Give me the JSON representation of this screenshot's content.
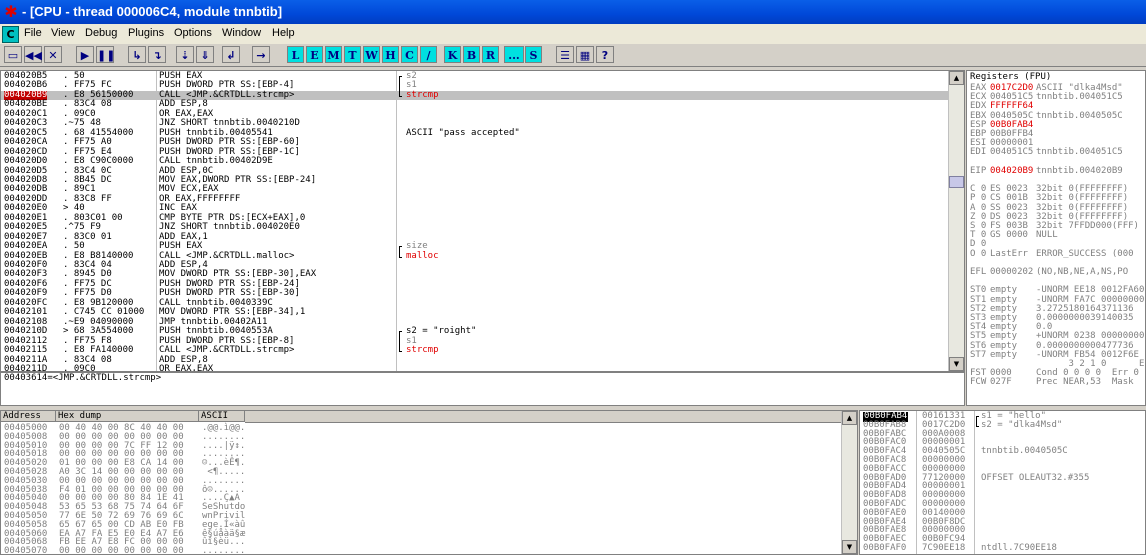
{
  "window": {
    "title": "- [CPU - thread 000006C4, module tnnbtib]",
    "app_icon": "bug-icon"
  },
  "menu": {
    "c_label": "C",
    "items": [
      "File",
      "View",
      "Debug",
      "Plugins",
      "Options",
      "Window",
      "Help"
    ]
  },
  "toolbar": {
    "icon_buttons": [
      "open-icon",
      "rewind-icon",
      "close-icon",
      "run-icon",
      "pause-icon",
      "step-into-icon",
      "step-over-icon",
      "trace-into-icon",
      "trace-over-icon",
      "execute-till-return-icon",
      "goto-icon"
    ],
    "letters": [
      "L",
      "E",
      "M",
      "T",
      "W",
      "H",
      "C",
      "/",
      "K",
      "B",
      "R",
      "...",
      "S"
    ],
    "right_icons": [
      "list-icon",
      "grid-icon",
      "help-icon"
    ]
  },
  "disasm": {
    "rows": [
      {
        "addr": "004020B5",
        "hex": ". 50",
        "cmd": "PUSH EAX",
        "cmt": "s2",
        "mark": "top",
        "cmt_color": "gray"
      },
      {
        "addr": "004020B6",
        "hex": ". FF75 FC",
        "cmd": "PUSH DWORD PTR SS:[EBP-4]",
        "cmt": "s1",
        "mark": "mid",
        "cmt_color": "gray"
      },
      {
        "addr": "004020B9",
        "hex": ". E8 56150000",
        "cmd": "CALL <JMP.&CRTDLL.strcmp>",
        "cmt": "strcmp",
        "mark": "bot",
        "cmt_color": "red",
        "selected": true
      },
      {
        "addr": "004020BE",
        "hex": ". 83C4 08",
        "cmd": "ADD ESP,8",
        "cmt": ""
      },
      {
        "addr": "004020C1",
        "hex": ". 09C0",
        "cmd": "OR EAX,EAX",
        "cmt": ""
      },
      {
        "addr": "004020C3",
        "hex": ".~75 48",
        "cmd": "JNZ SHORT tnnbtib.0040210D",
        "cmt": ""
      },
      {
        "addr": "004020C5",
        "hex": ". 68 41554000",
        "cmd": "PUSH tnnbtib.00405541",
        "cmt": "ASCII \"pass accepted\"",
        "cmt_color": "black"
      },
      {
        "addr": "004020CA",
        "hex": ". FF75 A0",
        "cmd": "PUSH DWORD PTR SS:[EBP-60]",
        "cmt": ""
      },
      {
        "addr": "004020CD",
        "hex": ". FF75 E4",
        "cmd": "PUSH DWORD PTR SS:[EBP-1C]",
        "cmt": ""
      },
      {
        "addr": "004020D0",
        "hex": ". E8 C90C0000",
        "cmd": "CALL tnnbtib.00402D9E",
        "cmt": ""
      },
      {
        "addr": "004020D5",
        "hex": ". 83C4 0C",
        "cmd": "ADD ESP,0C",
        "cmt": ""
      },
      {
        "addr": "004020D8",
        "hex": ". 8B45 DC",
        "cmd": "MOV EAX,DWORD PTR SS:[EBP-24]",
        "cmt": ""
      },
      {
        "addr": "004020DB",
        "hex": ". 89C1",
        "cmd": "MOV ECX,EAX",
        "cmt": ""
      },
      {
        "addr": "004020DD",
        "hex": ". 83C8 FF",
        "cmd": "OR EAX,FFFFFFFF",
        "cmt": ""
      },
      {
        "addr": "004020E0",
        "hex": "> 40",
        "cmd": "INC EAX",
        "cmt": ""
      },
      {
        "addr": "004020E1",
        "hex": ". 803C01 00",
        "cmd": "CMP BYTE PTR DS:[ECX+EAX],0",
        "cmt": ""
      },
      {
        "addr": "004020E5",
        "hex": ".^75 F9",
        "cmd": "JNZ SHORT tnnbtib.004020E0",
        "cmt": ""
      },
      {
        "addr": "004020E7",
        "hex": ". 83C0 01",
        "cmd": "ADD EAX,1",
        "cmt": ""
      },
      {
        "addr": "004020EA",
        "hex": ". 50",
        "cmd": "PUSH EAX",
        "cmt": "size",
        "mark": "top",
        "cmt_color": "gray"
      },
      {
        "addr": "004020EB",
        "hex": ". E8 B8140000",
        "cmd": "CALL <JMP.&CRTDLL.malloc>",
        "cmt": "malloc",
        "mark": "bot",
        "cmt_color": "red"
      },
      {
        "addr": "004020F0",
        "hex": ". 83C4 04",
        "cmd": "ADD ESP,4",
        "cmt": ""
      },
      {
        "addr": "004020F3",
        "hex": ". 8945 D0",
        "cmd": "MOV DWORD PTR SS:[EBP-30],EAX",
        "cmt": ""
      },
      {
        "addr": "004020F6",
        "hex": ". FF75 DC",
        "cmd": "PUSH DWORD PTR SS:[EBP-24]",
        "cmt": ""
      },
      {
        "addr": "004020F9",
        "hex": ". FF75 D0",
        "cmd": "PUSH DWORD PTR SS:[EBP-30]",
        "cmt": ""
      },
      {
        "addr": "004020FC",
        "hex": ". E8 9B120000",
        "cmd": "CALL tnnbtib.0040339C",
        "cmt": ""
      },
      {
        "addr": "00402101",
        "hex": ". C745 CC 01000",
        "cmd": "MOV DWORD PTR SS:[EBP-34],1",
        "cmt": ""
      },
      {
        "addr": "00402108",
        "hex": ".~E9 04090000",
        "cmd": "JMP tnnbtib.00402A11",
        "cmt": ""
      },
      {
        "addr": "0040210D",
        "hex": "> 68 3A554000",
        "cmd": "PUSH tnnbtib.0040553A",
        "cmt": "s2 = \"roight\"",
        "mark": "top",
        "cmt_color": "black"
      },
      {
        "addr": "00402112",
        "hex": ". FF75 F8",
        "cmd": "PUSH DWORD PTR SS:[EBP-8]",
        "cmt": "s1",
        "mark": "mid",
        "cmt_color": "gray"
      },
      {
        "addr": "00402115",
        "hex": ". E8 FA140000",
        "cmd": "CALL <JMP.&CRTDLL.strcmp>",
        "cmt": "strcmp",
        "mark": "bot",
        "cmt_color": "red"
      },
      {
        "addr": "0040211A",
        "hex": ". 83C4 08",
        "cmd": "ADD ESP,8",
        "cmt": ""
      },
      {
        "addr": "0040211D",
        "hex": ". 09C0",
        "cmd": "OR EAX,EAX",
        "cmt": ""
      },
      {
        "addr": "0040211F",
        "hex": ".~75 2A",
        "cmd": "JNZ SHORT tnnbtib.0040214B",
        "cmt": ""
      }
    ],
    "info": "00403614=<JMP.&CRTDLL.strcmp>"
  },
  "registers": {
    "header": "Registers (FPU)",
    "lines": [
      {
        "name": "EAX",
        "val": "0017C2D0",
        "desc": "ASCII \"dlka4Msd\"",
        "red": true
      },
      {
        "name": "ECX",
        "val": "004051C5",
        "desc": "tnnbtib.004051C5",
        "red": false
      },
      {
        "name": "EDX",
        "val": "FFFFFF64",
        "desc": "",
        "red": true
      },
      {
        "name": "EBX",
        "val": "0040505C",
        "desc": "tnnbtib.0040505C",
        "red": false
      },
      {
        "name": "ESP",
        "val": "00B0FAB4",
        "desc": "",
        "red": true
      },
      {
        "name": "EBP",
        "val": "00B0FFB4",
        "desc": "",
        "red": false
      },
      {
        "name": "ESI",
        "val": "00000001",
        "desc": "",
        "red": false
      },
      {
        "name": "EDI",
        "val": "004051C5",
        "desc": "tnnbtib.004051C5",
        "red": false
      },
      {
        "name": "",
        "val": "",
        "desc": "",
        "red": false
      },
      {
        "name": "EIP",
        "val": "004020B9",
        "desc": "tnnbtib.004020B9",
        "red": true
      },
      {
        "name": "",
        "val": "",
        "desc": "",
        "red": false
      },
      {
        "name": "C 0",
        "val": "ES 0023",
        "desc": "32bit 0(FFFFFFFF)",
        "red": false
      },
      {
        "name": "P 0",
        "val": "CS 001B",
        "desc": "32bit 0(FFFFFFFF)",
        "red": false
      },
      {
        "name": "A 0",
        "val": "SS 0023",
        "desc": "32bit 0(FFFFFFFF)",
        "red": false
      },
      {
        "name": "Z 0",
        "val": "DS 0023",
        "desc": "32bit 0(FFFFFFFF)",
        "red": false
      },
      {
        "name": "S 0",
        "val": "FS 003B",
        "desc": "32bit 7FFDD000(FFF)",
        "red": false
      },
      {
        "name": "T 0",
        "val": "GS 0000",
        "desc": "NULL",
        "red": false
      },
      {
        "name": "D 0",
        "val": "",
        "desc": "",
        "red": false
      },
      {
        "name": "O 0",
        "val": "LastErr",
        "desc": "ERROR_SUCCESS (000",
        "red": false
      },
      {
        "name": "",
        "val": "",
        "desc": "",
        "red": false
      },
      {
        "name": "EFL",
        "val": "00000202",
        "desc": "(NO,NB,NE,A,NS,PO",
        "red": false
      },
      {
        "name": "",
        "val": "",
        "desc": "",
        "red": false
      },
      {
        "name": "ST0",
        "val": "empty",
        "desc": "-UNORM EE18 0012FA60",
        "red": false
      },
      {
        "name": "ST1",
        "val": "empty",
        "desc": "-UNORM FA7C 00000000",
        "red": false
      },
      {
        "name": "ST2",
        "val": "empty",
        "desc": "3.2725180164371136",
        "red": false
      },
      {
        "name": "ST3",
        "val": "empty",
        "desc": "0.0000000039140035",
        "red": false
      },
      {
        "name": "ST4",
        "val": "empty",
        "desc": "0.0",
        "red": false
      },
      {
        "name": "ST5",
        "val": "empty",
        "desc": "+UNORM 0238 00000000",
        "red": false
      },
      {
        "name": "ST6",
        "val": "empty",
        "desc": "0.0000000000477736",
        "red": false
      },
      {
        "name": "ST7",
        "val": "empty",
        "desc": "-UNORM FB54 0012F6E",
        "red": false
      },
      {
        "name": "",
        "val": "",
        "desc": "      3 2 1 0      E",
        "red": false
      },
      {
        "name": "FST",
        "val": "0000",
        "desc": "Cond 0 0 0 0  Err 0",
        "red": false
      },
      {
        "name": "FCW",
        "val": "027F",
        "desc": "Prec NEAR,53  Mask",
        "red": false
      }
    ]
  },
  "dump": {
    "col_address": "Address",
    "col_hex": "Hex dump",
    "col_ascii": "ASCII",
    "rows": [
      {
        "addr": "00405000",
        "hex": "00 40 40 00 8C 40 40 00",
        "ascii": ".@@.ì@@."
      },
      {
        "addr": "00405008",
        "hex": "00 00 00 00 00 00 00 00",
        "ascii": "........"
      },
      {
        "addr": "00405010",
        "hex": "00 00 00 00 7C FF 12 00",
        "ascii": "....|ÿ↕."
      },
      {
        "addr": "00405018",
        "hex": "00 00 00 00 00 00 00 00",
        "ascii": "........"
      },
      {
        "addr": "00405020",
        "hex": "01 00 00 00 E8 CA 14 00",
        "ascii": "☺...èÊ¶."
      },
      {
        "addr": "00405028",
        "hex": "A0 3C 14 00 00 00 00 00",
        "ascii": " <¶....."
      },
      {
        "addr": "00405030",
        "hex": "00 00 00 00 00 00 00 00",
        "ascii": "........"
      },
      {
        "addr": "00405038",
        "hex": "F4 01 00 00 00 00 00 00",
        "ascii": "ô☺......"
      },
      {
        "addr": "00405040",
        "hex": "00 00 00 00 80 84 1E 41",
        "ascii": "....Ç▲A"
      },
      {
        "addr": "00405048",
        "hex": "53 65 53 68 75 74 64 6F",
        "ascii": "SeShutdo"
      },
      {
        "addr": "00405050",
        "hex": "77 6E 50 72 69 76 69 6C",
        "ascii": "wnPrivil"
      },
      {
        "addr": "00405058",
        "hex": "65 67 65 00 CD AB E0 FB",
        "ascii": "ege.Í«àû"
      },
      {
        "addr": "00405060",
        "hex": "EA A7 FA E5 E0 E4 A7 E6",
        "ascii": "ê§úåàä§æ"
      },
      {
        "addr": "00405068",
        "hex": "FB EE A7 E8 FC 00 00 00",
        "ascii": "ûî§èü..."
      },
      {
        "addr": "00405070",
        "hex": "00 00 00 00 00 00 00 00",
        "ascii": "........"
      }
    ]
  },
  "stack": {
    "rows": [
      {
        "addr": "00B0FAB4",
        "val": "00161331",
        "cmt": "s1 = \"hello\"",
        "mark": "top",
        "sel": true
      },
      {
        "addr": "00B0FAB8",
        "val": "0017C2D0",
        "cmt": "s2 = \"dlka4Msd\"",
        "mark": "bot"
      },
      {
        "addr": "00B0FABC",
        "val": "000A0008",
        "cmt": ""
      },
      {
        "addr": "00B0FAC0",
        "val": "00000001",
        "cmt": ""
      },
      {
        "addr": "00B0FAC4",
        "val": "0040505C",
        "cmt": "tnnbtib.0040505C"
      },
      {
        "addr": "00B0FAC8",
        "val": "00000000",
        "cmt": ""
      },
      {
        "addr": "00B0FACC",
        "val": "00000000",
        "cmt": ""
      },
      {
        "addr": "00B0FAD0",
        "val": "77120000",
        "cmt": "OFFSET OLEAUT32.#355"
      },
      {
        "addr": "00B0FAD4",
        "val": "00000001",
        "cmt": ""
      },
      {
        "addr": "00B0FAD8",
        "val": "00000000",
        "cmt": ""
      },
      {
        "addr": "00B0FADC",
        "val": "00000000",
        "cmt": ""
      },
      {
        "addr": "00B0FAE0",
        "val": "00140000",
        "cmt": ""
      },
      {
        "addr": "00B0FAE4",
        "val": "00B0F8DC",
        "cmt": ""
      },
      {
        "addr": "00B0FAE8",
        "val": "00000000",
        "cmt": ""
      },
      {
        "addr": "00B0FAEC",
        "val": "00B0FC94",
        "cmt": ""
      },
      {
        "addr": "00B0FAF0",
        "val": "7C90EE18",
        "cmt": "ntdll.7C90EE18"
      }
    ]
  }
}
